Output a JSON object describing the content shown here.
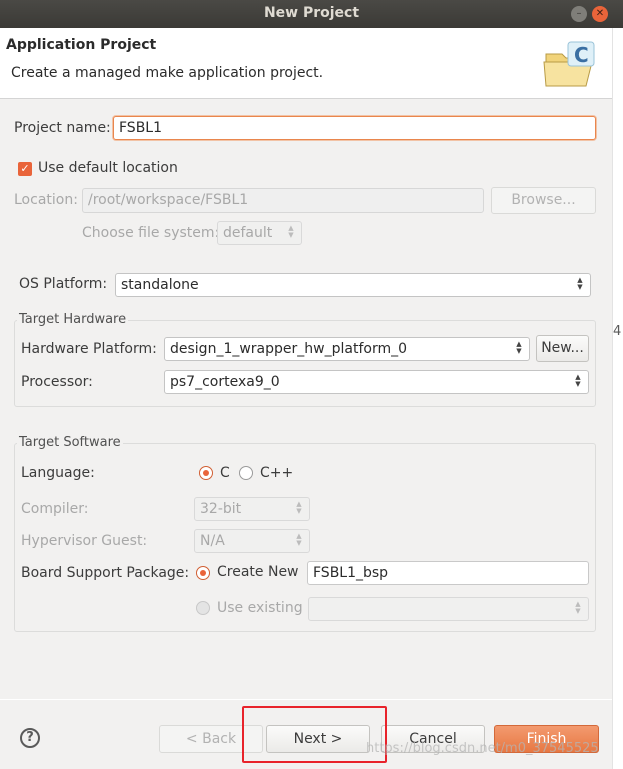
{
  "window": {
    "title": "New Project",
    "minimize_glyph": "–",
    "close_glyph": "✕"
  },
  "header": {
    "title": "Application Project",
    "description": "Create a managed make application project.",
    "icon": "c-project-folder-icon"
  },
  "project": {
    "name_label": "Project name:",
    "name_value": "FSBL1"
  },
  "location": {
    "use_default_label": "Use default location",
    "use_default_checked": true,
    "location_label": "Location:",
    "location_value": "/root/workspace/FSBL1",
    "browse_label": "Browse...",
    "file_system_label": "Choose file system:",
    "file_system_value": "default"
  },
  "os_platform": {
    "label": "OS Platform:",
    "value": "standalone"
  },
  "target_hardware": {
    "title": "Target Hardware",
    "hw_platform_label": "Hardware Platform:",
    "hw_platform_value": "design_1_wrapper_hw_platform_0",
    "new_button": "New...",
    "processor_label": "Processor:",
    "processor_value": "ps7_cortexa9_0"
  },
  "target_software": {
    "title": "Target Software",
    "language_label": "Language:",
    "language_options": [
      "C",
      "C++"
    ],
    "language_selected": "C",
    "compiler_label": "Compiler:",
    "compiler_value": "32-bit",
    "hypervisor_label": "Hypervisor Guest:",
    "hypervisor_value": "N/A",
    "bsp_label": "Board Support Package:",
    "bsp_create_new_label": "Create New",
    "bsp_create_new_value": "FSBL1_bsp",
    "bsp_use_existing_label": "Use existing",
    "bsp_selected": "Create New"
  },
  "footer": {
    "help_glyph": "?",
    "back_label": "< Back",
    "next_label": "Next >",
    "cancel_label": "Cancel",
    "finish_label": "Finish"
  },
  "side_fragment": "4",
  "watermark": "https://blog.csdn.net/m0_37545525",
  "colors": {
    "accent": "#e9643a",
    "highlight_box": "#e8232b",
    "title_bar": "#3b3a36"
  }
}
